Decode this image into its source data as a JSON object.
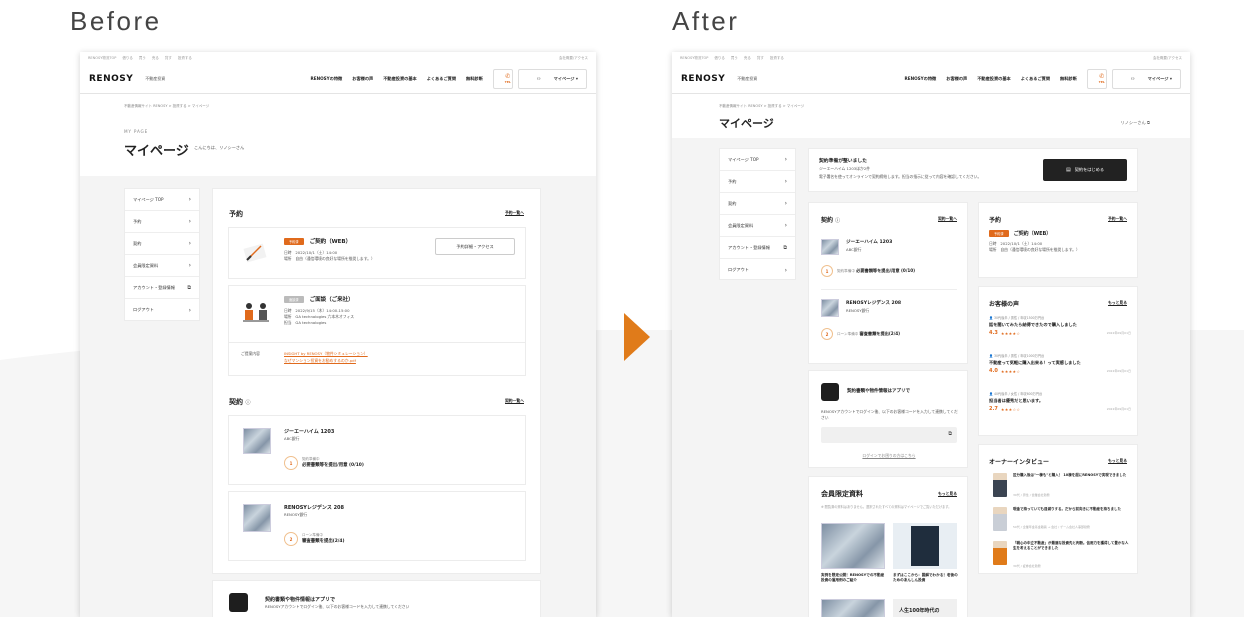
{
  "captions": {
    "before": "Before",
    "after": "After"
  },
  "colors": {
    "accent": "#e06a1c",
    "arrow": "#e07b1a"
  },
  "common": {
    "topstrip": [
      "RENOSY物流TOP",
      "借りる",
      "買う",
      "売る",
      "貸す",
      "投資する"
    ],
    "topstrip_right": "会社概要/アクセス",
    "logo": "RENOSY",
    "logo_sub": "不動産投資",
    "nav": [
      "RENOSYの特徴",
      "お客様の声",
      "不動産投資の基本",
      "よくあるご質問",
      "無料診断"
    ],
    "tel": "TEL",
    "mypage_btn": "マイページ ▾"
  },
  "before": {
    "crumb": "不動産情報サイト RENOSY > 投資する > マイページ",
    "mypage_en": "MY PAGE",
    "title": "マイページ",
    "greeting": "こんにちは、リノシーさん",
    "menu": [
      "マイページ TOP",
      "予約",
      "契約",
      "会員限定資料",
      "アカウント・登録情報",
      "ログアウト"
    ],
    "reserve": {
      "title": "予約",
      "link": "予約一覧へ",
      "item1": {
        "tag": "予約済",
        "name": "ご契約（WEB）",
        "date_label": "日時",
        "date": "2022/10/1（土）14:00",
        "place_label": "場所",
        "place": "自由（通信環境の良好な場所を推奨します。）",
        "btn": "予約詳細・アクセス"
      },
      "item2": {
        "tag": "面談済",
        "name": "ご面談（ご来社）",
        "date_label": "日時",
        "date": "2022/9/15（木）14:00-15:00",
        "place_label": "場所",
        "place": "GA technologies 六本木オフィス",
        "person_label": "担当",
        "person": "GA technologies"
      },
      "material_label": "ご提案内容",
      "material1": "INSIGHT by RENOSY（物件シミュレーション）",
      "material2": "なぜマンション投資をお勧めするのか.pdf"
    },
    "contract": {
      "title": "契約",
      "link": "契約一覧へ",
      "item1": {
        "name": "ジーエーハイム 1203",
        "bank": "ABC銀行",
        "step": "1",
        "status": "契約準備中",
        "task": "必要書類等を提出/用意 (0/10)"
      },
      "item2": {
        "name": "RENOSYレジデンス 208",
        "bank": "RENOSY銀行",
        "step": "2",
        "status": "ローン準備中",
        "task": "審査書類を提出(2/4)"
      }
    },
    "app": {
      "title": "契約書類や物件情報はアプリで",
      "desc": "RENOSYアカウントでログイン後、以下のお客様コードを入力して連携してください"
    }
  },
  "after": {
    "crumb": "不動産情報サイト RENOSY > 投資する > マイページ",
    "title": "マイページ",
    "user": "リノシーさん",
    "menu": [
      "マイページ TOP",
      "予約",
      "契約",
      "会員限定資料",
      "アカウント・登録情報",
      "ログアウト"
    ],
    "banner": {
      "title": "契約準備が整いました",
      "sub": "ジーエーハイム 1203ほか2件",
      "desc": "電子署名を使ってオンラインで契約締結します。担当の指示に従って内容を確認してください。",
      "btn": "契約をはじめる"
    },
    "contract": {
      "title": "契約",
      "link": "契約一覧へ",
      "item1": {
        "name": "ジーエーハイム 1203",
        "bank": "ABC銀行",
        "step": "1",
        "status": "契約準備中",
        "task": "必要書類等を提出/用意 (0/10)"
      },
      "item2": {
        "name": "RENOSYレジデンス 208",
        "bank": "RENOSY銀行",
        "step": "2",
        "status": "ローン準備中",
        "task": "審査書類を提出(2/4)"
      }
    },
    "app": {
      "title": "契約書類や物件情報はアプリで",
      "desc": "RENOSYアカウントでログイン後、以下のお客様コードを入力して連携してください",
      "login_link": "ログインでお困りの方はこちら"
    },
    "materials": {
      "title": "会員限定資料",
      "link": "もっと見る",
      "desc": "※ 閲覧済の資料はありません。選択されたすべての資料はマイページでご覧いただけます。",
      "doc1": "実例を限定公開！RENOSYでの不動産投資の運用例のご紹介",
      "doc2": "まずはここから：図解でわかる！老後のためのあんしん投資",
      "doc3_caption": "人生100年時代の"
    },
    "reserve": {
      "title": "予約",
      "link": "予約一覧へ",
      "tag": "予約済",
      "name": "ご契約（WEB）",
      "date_label": "日時",
      "date": "2022/10/1（土）14:00",
      "place_label": "場所",
      "place": "自由（通信環境の良好な場所を推奨します。）"
    },
    "voices": {
      "title": "お客様の声",
      "link": "もっと見る",
      "items": [
        {
          "meta": "30代後半 / 男性 / 年収1500万円台",
          "text": "話を聞いてみたら納得できたので購入しました",
          "score": "4.3",
          "stars": "★★★★☆",
          "date": "2022年09月01日"
        },
        {
          "meta": "30代後半 / 男性 / 年収1000万円台",
          "text": "不動産って気軽に購入出来る！って実感しました",
          "score": "4.0",
          "stars": "★★★★☆",
          "date": "2022年09月01日"
        },
        {
          "meta": "40代後半 / 女性 / 年収600万円台",
          "text": "担当者は優秀だと思います。",
          "score": "2.7",
          "stars": "★★★☆☆",
          "date": "2022年09月01日"
        }
      ]
    },
    "interviews": {
      "title": "オーナーインタビュー",
      "link": "もっと見る",
      "items": [
        {
          "text": "区分購入後は\"一棟も\"と購入！ 10棟を超にRENOSYで実現できました",
          "meta": "30代 / 男性 / 営業会社勤務"
        },
        {
          "text": "現金で持っていても目減りする。だから前向きに不動産を持ちました",
          "meta": "50代 / 企業年金基金職員 → 会社 / ゲーム会社人事部勤務"
        },
        {
          "text": "「親心の中立不動産」が最適な投資先と判断。信用力を獲得して豊かな人生を考えることができました",
          "meta": "30代 / 証券会社勤務"
        }
      ]
    }
  }
}
